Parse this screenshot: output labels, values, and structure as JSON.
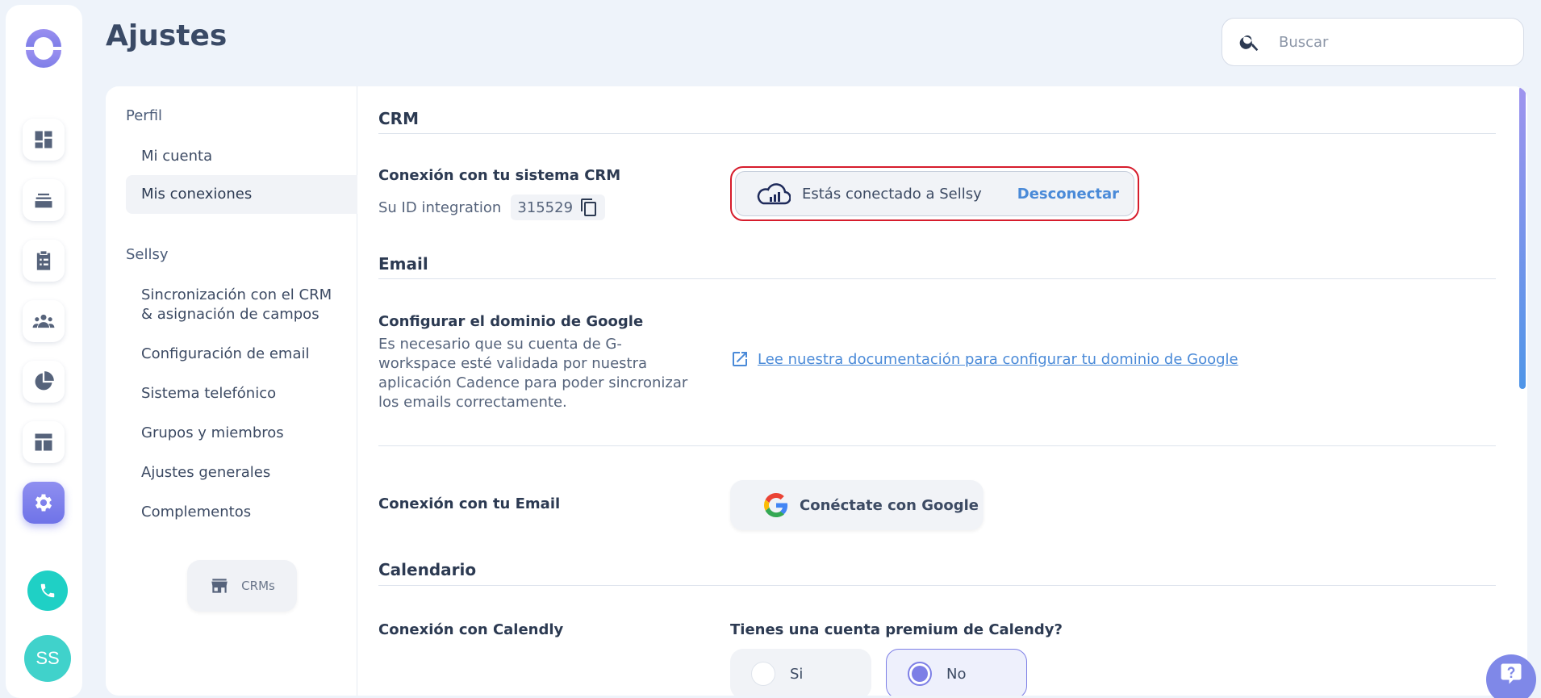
{
  "app": {
    "page_title": "Ajustes",
    "avatar_initials": "SS"
  },
  "search": {
    "placeholder": "Buscar",
    "value": ""
  },
  "rail": {
    "icons": [
      "logo-icon",
      "dashboard-icon",
      "inbox-icon",
      "tasks-icon",
      "contacts-icon",
      "analytics-icon",
      "layout-icon",
      "settings-icon",
      "phone-icon"
    ],
    "active": "settings-icon",
    "accent_color": "#7a7ceb",
    "phone_color": "#1fd0c5",
    "avatar_color": "#40d2cb"
  },
  "subnav": {
    "sections": [
      {
        "title": "Perfil",
        "items": [
          "Mi cuenta",
          "Mis conexiones"
        ]
      },
      {
        "title": "Sellsy",
        "items": [
          "Sincronización con el CRM & asignación de campos",
          "Configuración de email",
          "Sistema telefónico",
          "Grupos y miembros",
          "Ajustes generales",
          "Complementos"
        ]
      }
    ],
    "active_item": "Mis conexiones",
    "crm_button": "CRMs"
  },
  "crm": {
    "section_title": "CRM",
    "label": "Conexión con tu sistema CRM",
    "id_label": "Su ID integration",
    "id_value": "315529",
    "status_text": "Estás conectado a Sellsy",
    "disconnect_label": "Desconectar"
  },
  "email": {
    "section_title": "Email",
    "google_domain_label": "Configurar el dominio de Google",
    "google_domain_desc": "Es necesario que su cuenta de G-workspace esté validada por nuestra aplicación Cadence para poder sincronizar los emails correctamente.",
    "doc_link": " Lee nuestra documentación para configurar tu dominio de Google",
    "connect_label": "Conexión con tu Email",
    "google_button": "Conéctate con Google"
  },
  "calendar": {
    "section_title": "Calendario",
    "calendly_label": "Conexión con Calendly",
    "question": "Tienes una cuenta premium de Calendy?",
    "options": [
      "Si",
      "No"
    ],
    "selected": "No"
  },
  "colors": {
    "link": "#4a8ad8",
    "highlight_border": "#d61c2c",
    "radio_selected": "#7d7fe6"
  }
}
